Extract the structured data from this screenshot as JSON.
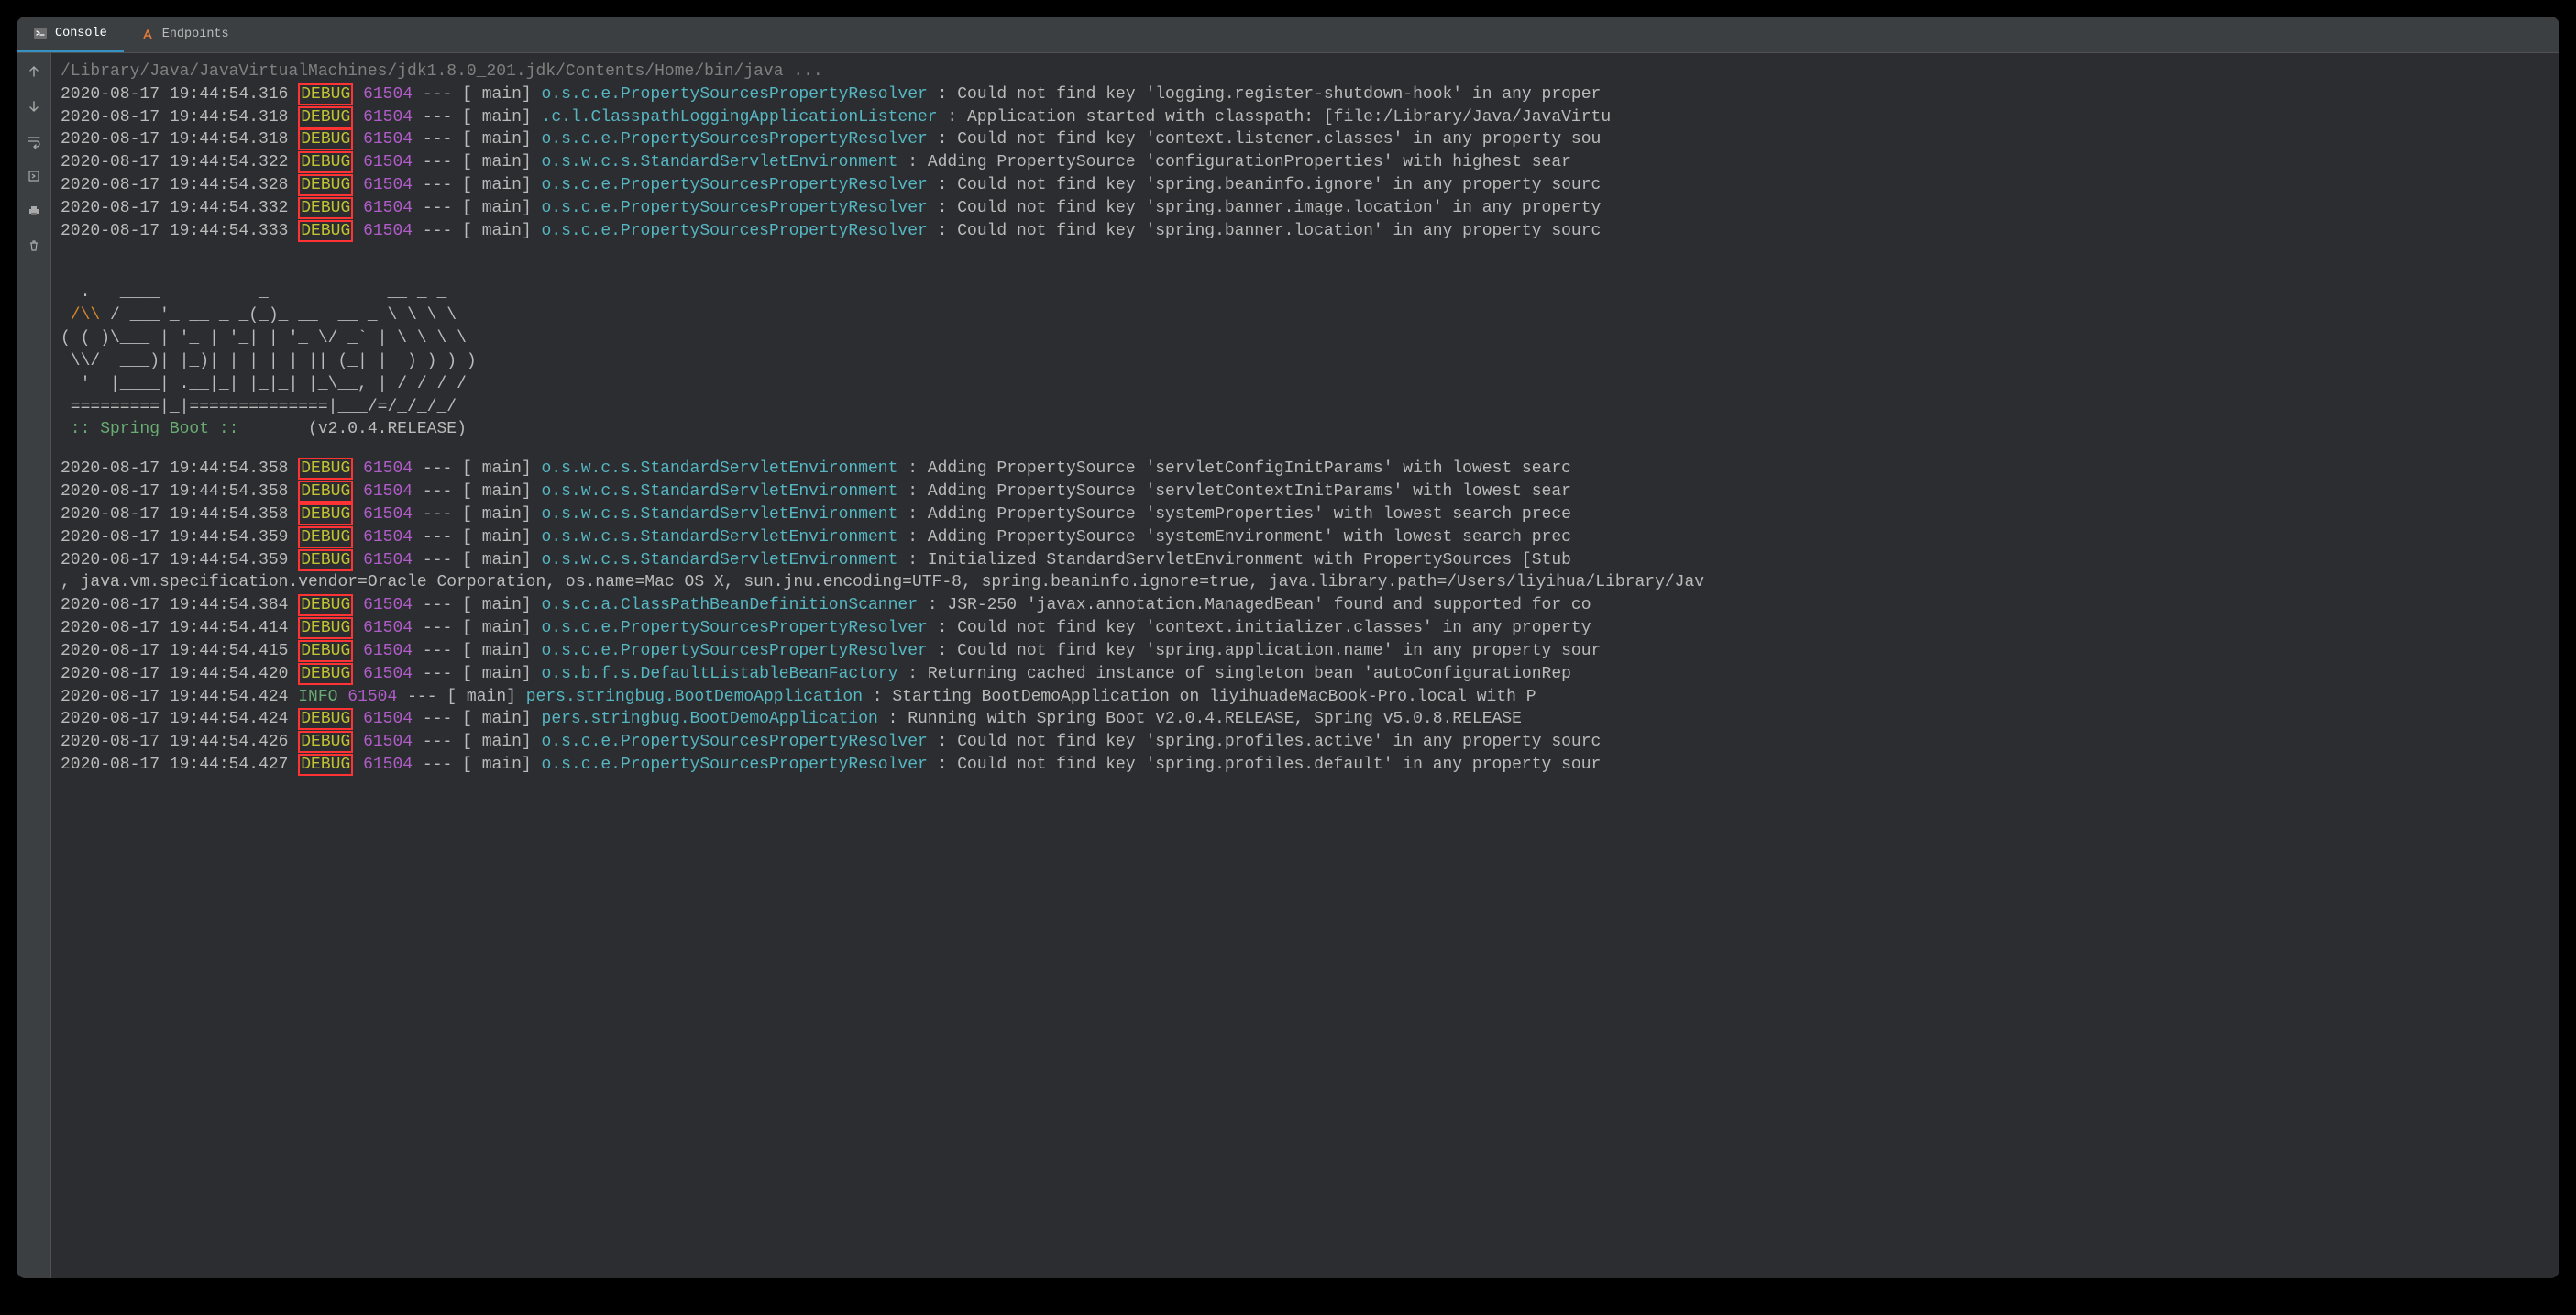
{
  "tabs": {
    "console": "Console",
    "endpoints": "Endpoints"
  },
  "command_line": "/Library/Java/JavaVirtualMachines/jdk1.8.0_201.jdk/Contents/Home/bin/java ...",
  "pid": "61504",
  "thread": "main",
  "banner": {
    "l1": "  .   ____          _            __ _ _",
    "l2_pre": " /\\\\ ",
    "l2_post": "/ ___'_ __ _ _(_)_ __  __ _ \\ \\ \\ \\",
    "l3": "( ( )\\___ | '_ | '_| | '_ \\/ _` | \\ \\ \\ \\",
    "l4": " \\\\/  ___)| |_)| | | | | || (_| |  ) ) ) )",
    "l5": "  '  |____| .__|_| |_|_| |_\\__, | / / / /",
    "l6": " =========|_|==============|___/=/_/_/_/",
    "spring": " :: Spring Boot ::       ",
    "version": "(v2.0.4.RELEASE)"
  },
  "logs": [
    {
      "ts": "2020-08-17 19:44:54.316",
      "lvl": "DEBUG",
      "box": true,
      "logger": "o.s.c.e.PropertySourcesPropertyResolver",
      "msg": "Could not find key 'logging.register-shutdown-hook' in any proper"
    },
    {
      "ts": "2020-08-17 19:44:54.318",
      "lvl": "DEBUG",
      "box": true,
      "logger": ".c.l.ClasspathLoggingApplicationListener",
      "msg": "Application started with classpath: [file:/Library/Java/JavaVirtu"
    },
    {
      "ts": "2020-08-17 19:44:54.318",
      "lvl": "DEBUG",
      "box": true,
      "logger": "o.s.c.e.PropertySourcesPropertyResolver",
      "msg": "Could not find key 'context.listener.classes' in any property sou"
    },
    {
      "ts": "2020-08-17 19:44:54.322",
      "lvl": "DEBUG",
      "box": true,
      "logger": "o.s.w.c.s.StandardServletEnvironment",
      "msg": "Adding PropertySource 'configurationProperties' with highest sear"
    },
    {
      "ts": "2020-08-17 19:44:54.328",
      "lvl": "DEBUG",
      "box": true,
      "logger": "o.s.c.e.PropertySourcesPropertyResolver",
      "msg": "Could not find key 'spring.beaninfo.ignore' in any property sourc"
    },
    {
      "ts": "2020-08-17 19:44:54.332",
      "lvl": "DEBUG",
      "box": true,
      "logger": "o.s.c.e.PropertySourcesPropertyResolver",
      "msg": "Could not find key 'spring.banner.image.location' in any property"
    },
    {
      "ts": "2020-08-17 19:44:54.333",
      "lvl": "DEBUG",
      "box": true,
      "logger": "o.s.c.e.PropertySourcesPropertyResolver",
      "msg": "Could not find key 'spring.banner.location' in any property sourc"
    }
  ],
  "logs2": [
    {
      "ts": "2020-08-17 19:44:54.358",
      "lvl": "DEBUG",
      "box": true,
      "logger": "o.s.w.c.s.StandardServletEnvironment",
      "msg": "Adding PropertySource 'servletConfigInitParams' with lowest searc"
    },
    {
      "ts": "2020-08-17 19:44:54.358",
      "lvl": "DEBUG",
      "box": true,
      "logger": "o.s.w.c.s.StandardServletEnvironment",
      "msg": "Adding PropertySource 'servletContextInitParams' with lowest sear"
    },
    {
      "ts": "2020-08-17 19:44:54.358",
      "lvl": "DEBUG",
      "box": true,
      "logger": "o.s.w.c.s.StandardServletEnvironment",
      "msg": "Adding PropertySource 'systemProperties' with lowest search prece"
    },
    {
      "ts": "2020-08-17 19:44:54.359",
      "lvl": "DEBUG",
      "box": true,
      "logger": "o.s.w.c.s.StandardServletEnvironment",
      "msg": "Adding PropertySource 'systemEnvironment' with lowest search prec"
    },
    {
      "ts": "2020-08-17 19:44:54.359",
      "lvl": "DEBUG",
      "box": true,
      "logger": "o.s.w.c.s.StandardServletEnvironment",
      "msg": "Initialized StandardServletEnvironment with PropertySources [Stub"
    }
  ],
  "wrap_line": ", java.vm.specification.vendor=Oracle Corporation, os.name=Mac OS X, sun.jnu.encoding=UTF-8, spring.beaninfo.ignore=true, java.library.path=/Users/liyihua/Library/Jav",
  "logs3": [
    {
      "ts": "2020-08-17 19:44:54.384",
      "lvl": "DEBUG",
      "box": true,
      "logger": "o.s.c.a.ClassPathBeanDefinitionScanner",
      "msg": "JSR-250 'javax.annotation.ManagedBean' found and supported for co"
    },
    {
      "ts": "2020-08-17 19:44:54.414",
      "lvl": "DEBUG",
      "box": true,
      "logger": "o.s.c.e.PropertySourcesPropertyResolver",
      "msg": "Could not find key 'context.initializer.classes' in any property "
    },
    {
      "ts": "2020-08-17 19:44:54.415",
      "lvl": "DEBUG",
      "box": true,
      "logger": "o.s.c.e.PropertySourcesPropertyResolver",
      "msg": "Could not find key 'spring.application.name' in any property sour"
    },
    {
      "ts": "2020-08-17 19:44:54.420",
      "lvl": "DEBUG",
      "box": true,
      "logger": "o.s.b.f.s.DefaultListableBeanFactory",
      "msg": "Returning cached instance of singleton bean 'autoConfigurationRep"
    },
    {
      "ts": "2020-08-17 19:44:54.424",
      "lvl": "INFO",
      "box": false,
      "logger": "pers.stringbug.BootDemoApplication",
      "msg": "Starting BootDemoApplication on liyihuadeMacBook-Pro.local with P"
    },
    {
      "ts": "2020-08-17 19:44:54.424",
      "lvl": "DEBUG",
      "box": true,
      "logger": "pers.stringbug.BootDemoApplication",
      "msg": "Running with Spring Boot v2.0.4.RELEASE, Spring v5.0.8.RELEASE"
    },
    {
      "ts": "2020-08-17 19:44:54.426",
      "lvl": "DEBUG",
      "box": true,
      "logger": "o.s.c.e.PropertySourcesPropertyResolver",
      "msg": "Could not find key 'spring.profiles.active' in any property sourc"
    },
    {
      "ts": "2020-08-17 19:44:54.427",
      "lvl": "DEBUG",
      "box": true,
      "logger": "o.s.c.e.PropertySourcesPropertyResolver",
      "msg": "Could not find key 'spring.profiles.default' in any property sour"
    }
  ]
}
